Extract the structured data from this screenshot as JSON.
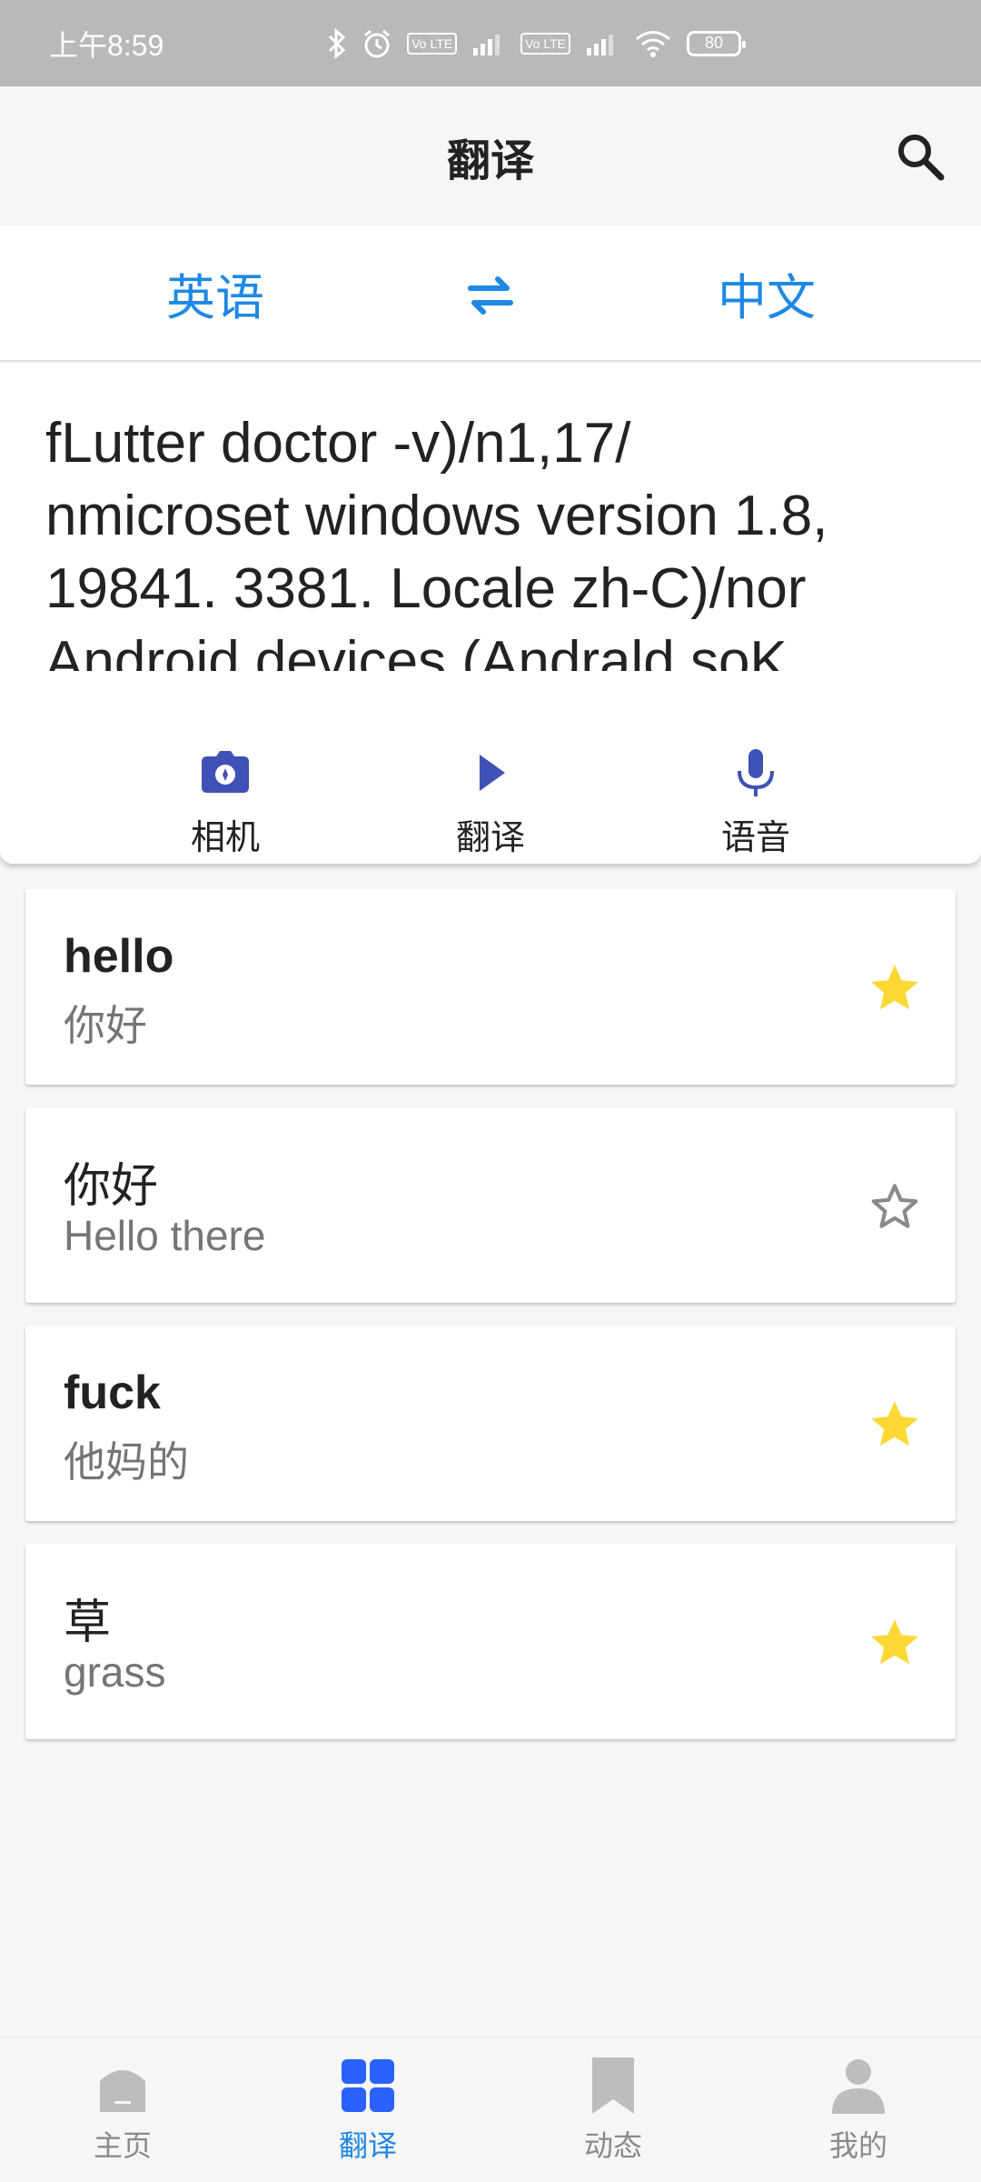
{
  "status_bar": {
    "time": "上午8:59",
    "lte1": "Vo LTE",
    "lte2": "Vo LTE",
    "battery": "80",
    "icons": [
      "bluetooth-icon",
      "alarm-icon",
      "signal-icon",
      "wifi-icon",
      "battery-icon"
    ]
  },
  "app_bar": {
    "title": "翻译",
    "search_icon": "search-icon"
  },
  "language_bar": {
    "source": "英语",
    "target": "中文",
    "swap_icon": "swap-icon",
    "accent": "#1e88e5"
  },
  "input": {
    "text": "fLutter doctor -v)/n1,17/\nnmicroset windows version 1.8,\n19841. 3381. Locale zh-C)/nor\nAndroid devices (Andrald soK"
  },
  "actions": [
    {
      "label": "相机",
      "icon": "camera-icon"
    },
    {
      "label": "翻译",
      "icon": "play-icon"
    },
    {
      "label": "语音",
      "icon": "microphone-icon"
    }
  ],
  "history": [
    {
      "source": "hello",
      "target": "你好",
      "starred": true,
      "bold": true
    },
    {
      "source": "你好",
      "target": "Hello there",
      "starred": false,
      "bold": false
    },
    {
      "source": "fuck",
      "target": "他妈的",
      "starred": true,
      "bold": true
    },
    {
      "source": "草",
      "target": "grass",
      "starred": true,
      "bold": false
    }
  ],
  "bottom_nav": [
    {
      "label": "主页",
      "icon": "home-icon",
      "active": false
    },
    {
      "label": "翻译",
      "icon": "grid-icon",
      "active": true
    },
    {
      "label": "动态",
      "icon": "bookmark-icon",
      "active": false
    },
    {
      "label": "我的",
      "icon": "person-icon",
      "active": false
    }
  ],
  "colors": {
    "accent_blue": "#1e88e5",
    "action_indigo": "#3f51b5",
    "star_yellow": "#fdd835",
    "star_outline": "#8a8a8a",
    "nav_active": "#2962ff"
  }
}
